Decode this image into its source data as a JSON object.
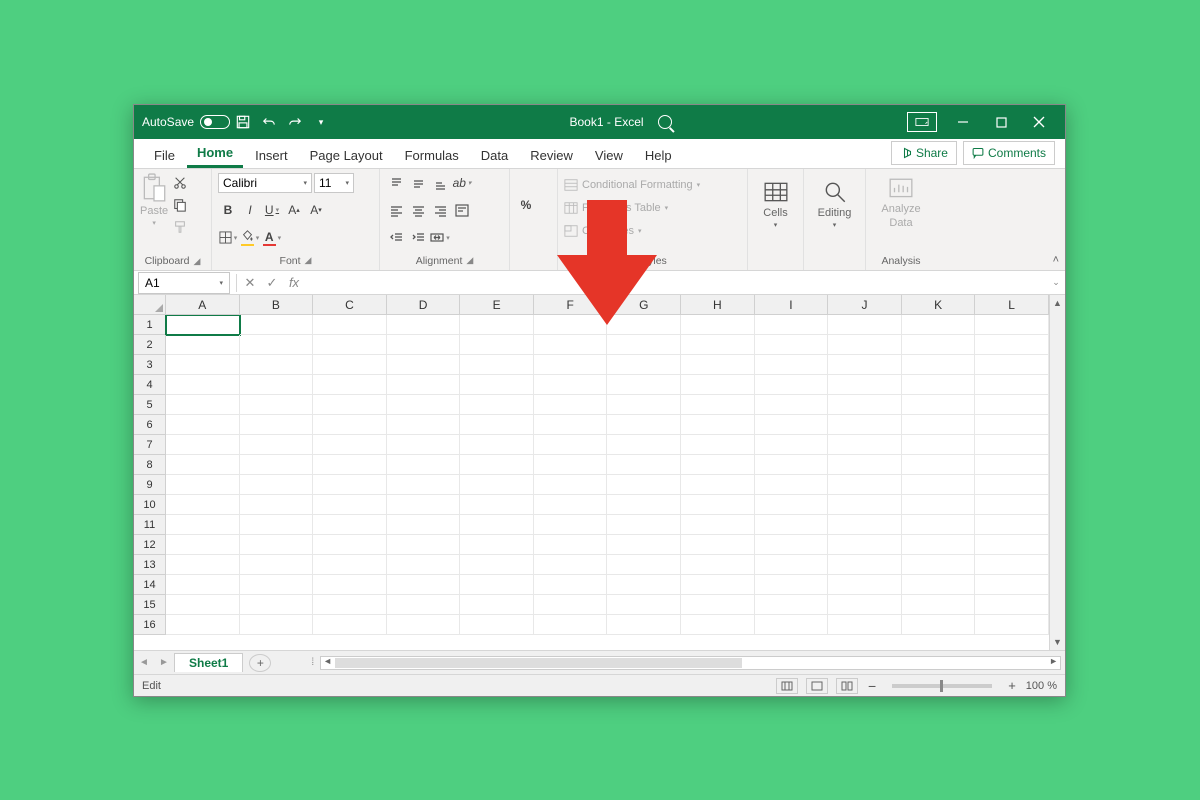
{
  "titlebar": {
    "autosave_label": "AutoSave",
    "autosave_state": "Off",
    "doc_title": "Book1 - Excel"
  },
  "tabs": [
    "File",
    "Home",
    "Insert",
    "Page Layout",
    "Formulas",
    "Data",
    "Review",
    "View",
    "Help"
  ],
  "active_tab": "Home",
  "share_label": "Share",
  "comments_label": "Comments",
  "ribbon": {
    "clipboard": {
      "paste": "Paste",
      "label": "Clipboard"
    },
    "font": {
      "name": "Calibri",
      "size": "11",
      "bold": "B",
      "italic": "I",
      "underline": "U",
      "label": "Font"
    },
    "alignment": {
      "label": "Alignment"
    },
    "number": {
      "percent": "%"
    },
    "styles": {
      "cond": "Conditional Formatting",
      "table_fmt": "Format as Table",
      "cell_styles": "Cell Styles",
      "label": "Styles"
    },
    "cells": {
      "label": "Cells"
    },
    "editing": {
      "label": "Editing"
    },
    "analysis": {
      "analyze": "Analyze",
      "data": "Data",
      "label": "Analysis"
    }
  },
  "formula_bar": {
    "cell_ref": "A1",
    "formula": ""
  },
  "columns": [
    "A",
    "B",
    "C",
    "D",
    "E",
    "F",
    "G",
    "H",
    "I",
    "J",
    "K",
    "L"
  ],
  "row_count": 16,
  "selected_cell": "A1",
  "sheet_tab": "Sheet1",
  "status": {
    "mode": "Edit",
    "zoom": "100 %"
  }
}
